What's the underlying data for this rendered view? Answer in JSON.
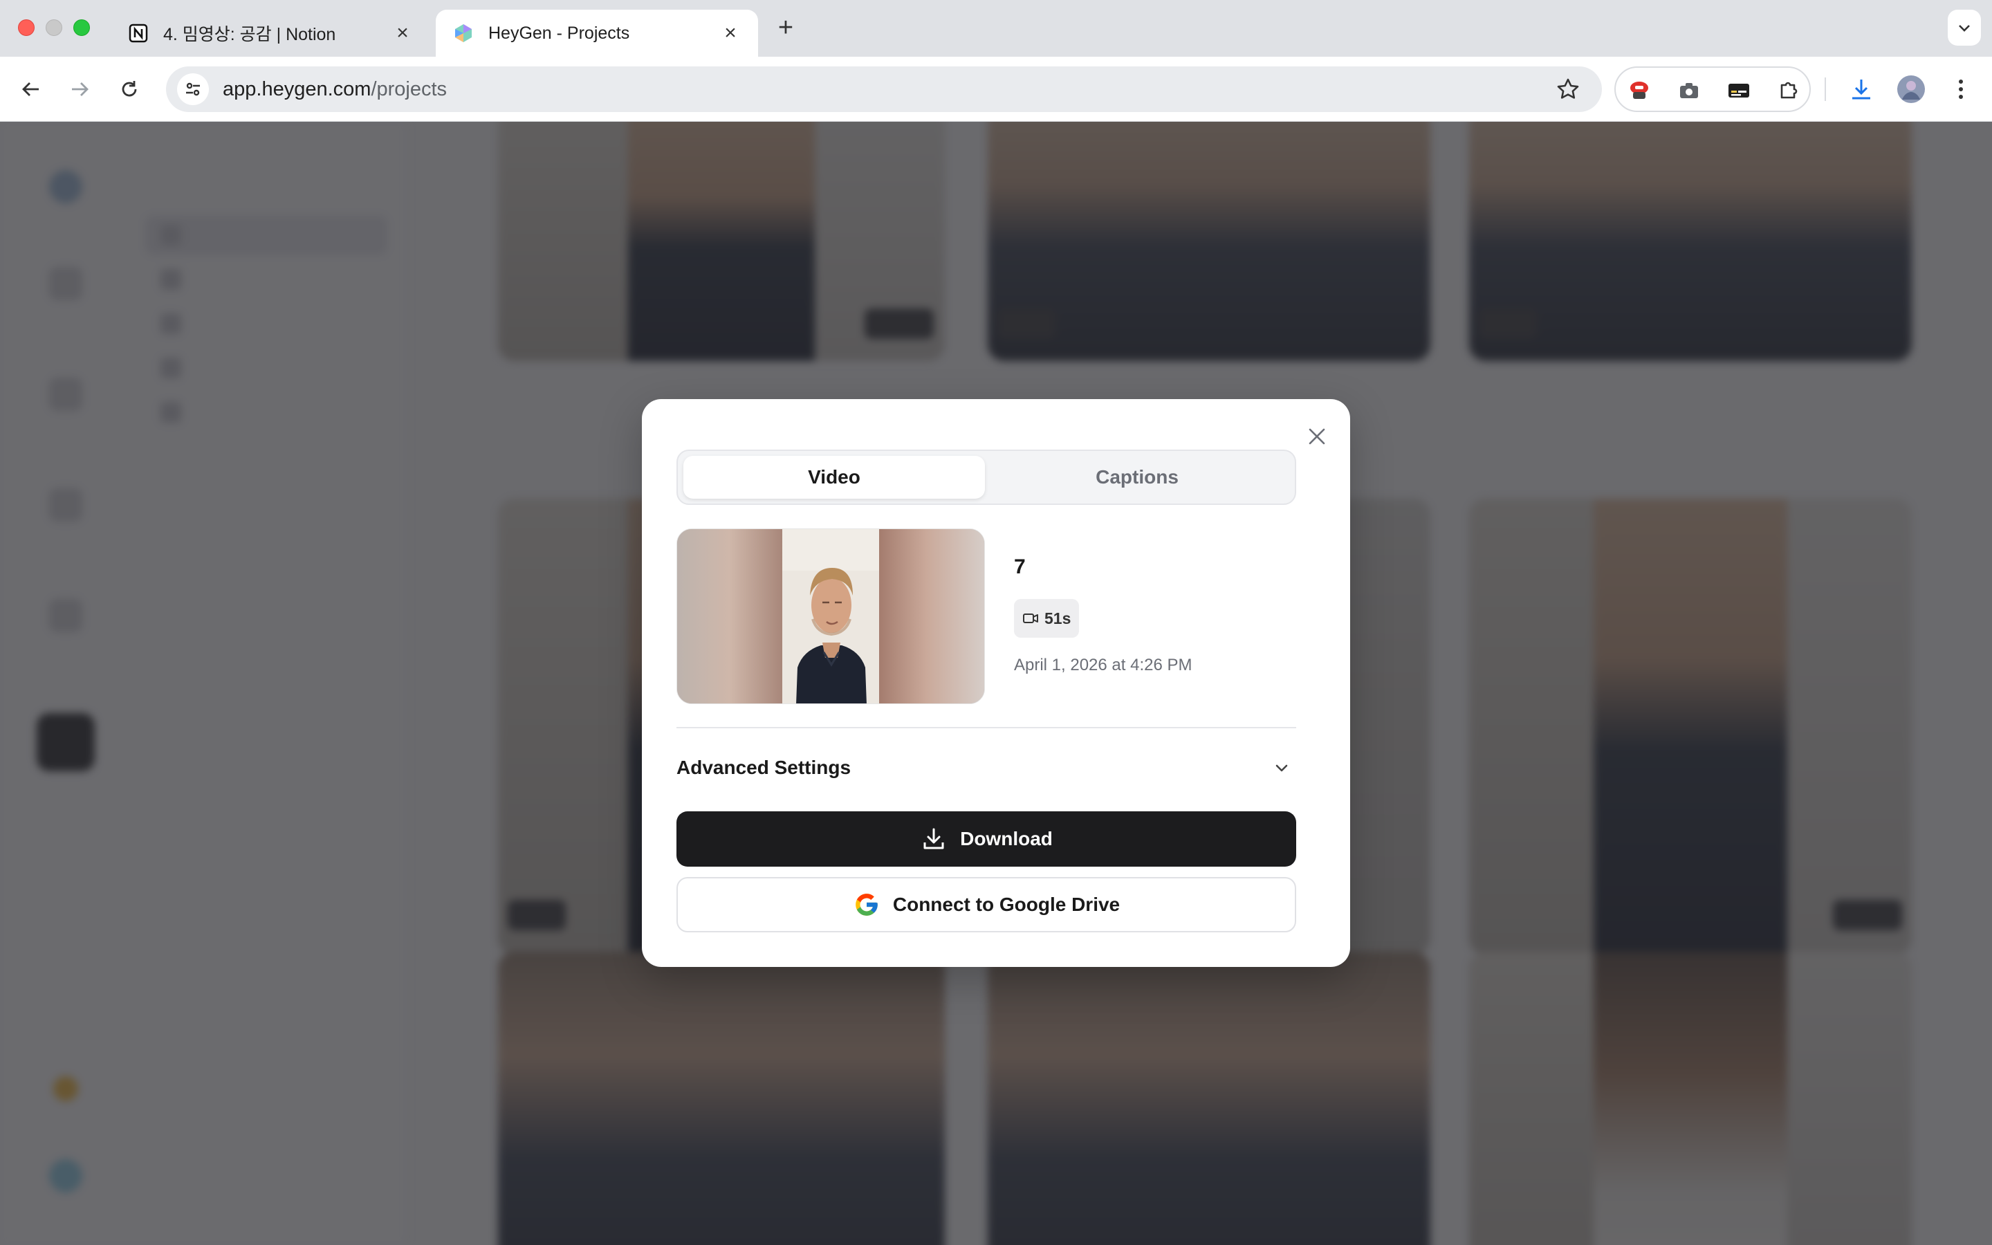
{
  "browser": {
    "tabs": [
      {
        "title": "4. 밈영상: 공감 | Notion",
        "favicon": "notion-icon",
        "active": false
      },
      {
        "title": "HeyGen - Projects",
        "favicon": "heygen-icon",
        "active": true
      }
    ],
    "url_host": "app.heygen.com",
    "url_path": "/projects",
    "extensions": [
      "red-extension-icon",
      "camera-icon",
      "caption-icon",
      "puzzle-icon"
    ]
  },
  "modal": {
    "tabs": {
      "video": "Video",
      "captions": "Captions"
    },
    "active_tab": "Video",
    "video": {
      "name": "7",
      "duration": "51s",
      "date": "April 1, 2026 at 4:26 PM"
    },
    "advanced_settings_label": "Advanced Settings",
    "download_label": "Download",
    "google_drive_label": "Connect to Google Drive"
  },
  "colors": {
    "primary_button": "#1c1c1e",
    "overlay": "#28282c"
  }
}
